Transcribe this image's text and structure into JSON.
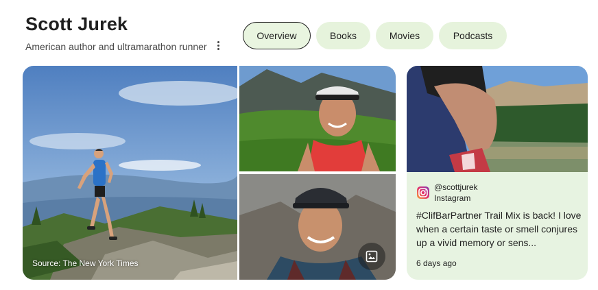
{
  "header": {
    "title": "Scott Jurek",
    "subtitle": "American author and ultramarathon runner"
  },
  "tabs": [
    {
      "label": "Overview",
      "active": true
    },
    {
      "label": "Books",
      "active": false
    },
    {
      "label": "Movies",
      "active": false
    },
    {
      "label": "Podcasts",
      "active": false
    }
  ],
  "gallery": {
    "main_caption": "Source: The New York Times"
  },
  "instagram_post": {
    "handle": "@scottjurek",
    "platform": "Instagram",
    "text": "#ClifBarPartner Trail Mix is back! I love when a certain taste or smell conjures up a vivid memory or sens...",
    "time": "6 days ago"
  },
  "colors": {
    "chip_bg": "#e6f3dc",
    "card_bg": "#e7f3e1",
    "sky": "#7aa7d6",
    "forest": "#3f6b2f"
  }
}
